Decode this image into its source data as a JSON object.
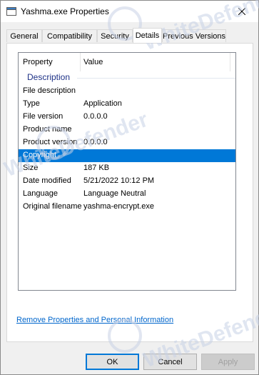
{
  "window": {
    "title": "Yashma.exe Properties"
  },
  "tabs": [
    {
      "label": "General"
    },
    {
      "label": "Compatibility"
    },
    {
      "label": "Security"
    },
    {
      "label": "Details"
    },
    {
      "label": "Previous Versions"
    }
  ],
  "details": {
    "columns": {
      "property": "Property",
      "value": "Value"
    },
    "group": "Description",
    "rows": [
      {
        "property": "File description",
        "value": ""
      },
      {
        "property": "Type",
        "value": "Application"
      },
      {
        "property": "File version",
        "value": "0.0.0.0"
      },
      {
        "property": "Product name",
        "value": ""
      },
      {
        "property": "Product version",
        "value": "0.0.0.0"
      },
      {
        "property": "Copyright",
        "value": ""
      },
      {
        "property": "Size",
        "value": "187 KB"
      },
      {
        "property": "Date modified",
        "value": "5/21/2022 10:12 PM"
      },
      {
        "property": "Language",
        "value": "Language Neutral"
      },
      {
        "property": "Original filename",
        "value": "yashma-encrypt.exe"
      }
    ],
    "selected_row": "Copyright"
  },
  "link": {
    "label": "Remove Properties and Personal Information"
  },
  "buttons": {
    "ok": "OK",
    "cancel": "Cancel",
    "apply": "Apply"
  },
  "watermark": {
    "text": "WhiteDefender"
  },
  "colors": {
    "selection": "#0078d7",
    "link": "#0066cc",
    "group_header": "#1e3287"
  }
}
